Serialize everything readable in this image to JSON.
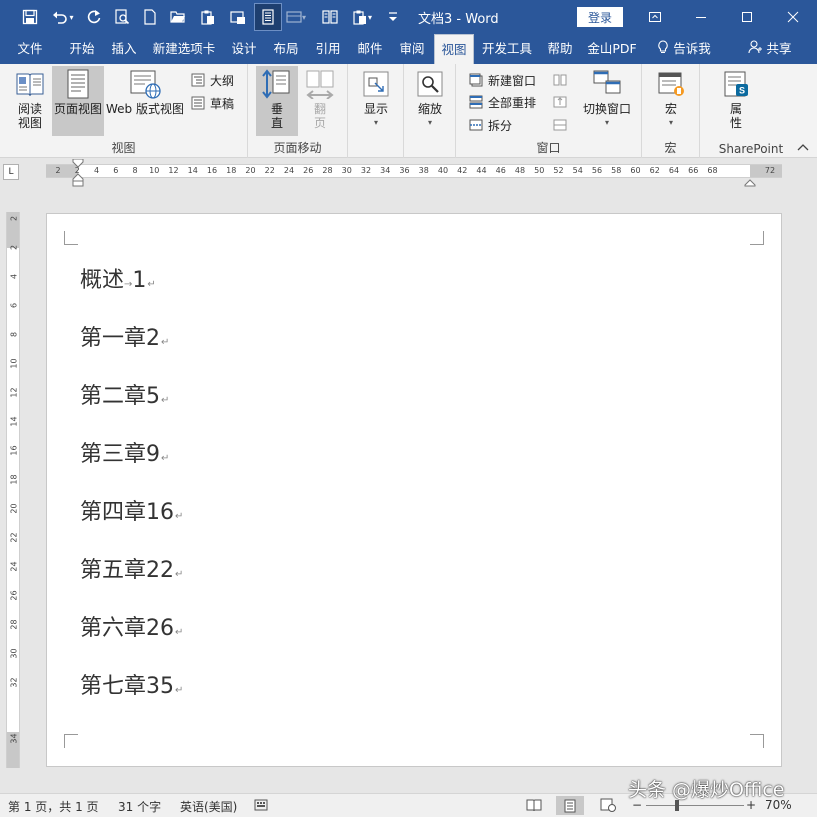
{
  "titlebar": {
    "doc_title": "文档3  -  Word",
    "login_label": "登录",
    "qat_icons": [
      "save-icon",
      "undo-icon",
      "redo-icon",
      "print-preview-icon",
      "new-doc-icon",
      "open-folder-icon",
      "paste-icon",
      "screenshot-icon",
      "one-page-icon",
      "multi-page-icon",
      "side-by-side-icon",
      "paste-special-icon",
      "customize-qat-icon"
    ],
    "window_controls": [
      "ribbon-display-icon",
      "minimize-icon",
      "maximize-icon",
      "close-icon"
    ]
  },
  "tabs": [
    {
      "label": "文件"
    },
    {
      "label": "开始"
    },
    {
      "label": "插入"
    },
    {
      "label": "新建选项卡"
    },
    {
      "label": "设计"
    },
    {
      "label": "布局"
    },
    {
      "label": "引用"
    },
    {
      "label": "邮件"
    },
    {
      "label": "审阅"
    },
    {
      "label": "视图",
      "active": true
    },
    {
      "label": "开发工具"
    },
    {
      "label": "帮助"
    },
    {
      "label": "金山PDF"
    },
    {
      "label": "告诉我"
    },
    {
      "label": "共享"
    }
  ],
  "ribbon": {
    "views": {
      "read_line1": "阅读",
      "read_line2": "视图",
      "page_view": "页面视图",
      "web_view": "Web 版式视图",
      "outline": "大纲",
      "draft": "草稿",
      "group_label": "视图"
    },
    "page_movement": {
      "vertical_line1": "垂",
      "vertical_line2": "直",
      "flip_line1": "翻",
      "flip_line2": "页",
      "group_label": "页面移动"
    },
    "show": {
      "label": "显示"
    },
    "zoom": {
      "label": "缩放"
    },
    "window": {
      "new_window": "新建窗口",
      "arrange_all": "全部重排",
      "split": "拆分",
      "switch_windows": "切换窗口",
      "group_label": "窗口"
    },
    "macros": {
      "label": "宏",
      "group_label": "宏"
    },
    "sharepoint": {
      "line1": "属",
      "line2": "性",
      "group_label": "SharePoint"
    }
  },
  "ruler": {
    "h_ticks": [
      "2",
      "2",
      "4",
      "6",
      "8",
      "10",
      "12",
      "14",
      "16",
      "18",
      "20",
      "22",
      "24",
      "26",
      "28",
      "30",
      "32",
      "34",
      "36",
      "38",
      "40",
      "42",
      "44",
      "46",
      "48",
      "50",
      "52",
      "54",
      "56",
      "58",
      "60",
      "62",
      "64",
      "66",
      "68",
      "72"
    ],
    "v_ticks": [
      "2",
      "2",
      "4",
      "6",
      "8",
      "10",
      "12",
      "14",
      "16",
      "18",
      "20",
      "22",
      "24",
      "26",
      "28",
      "30",
      "32",
      "34"
    ],
    "corner_symbol": "L"
  },
  "document": {
    "toc_lines": [
      {
        "title": "概述",
        "page": "1"
      },
      {
        "title": "第一章",
        "page": "2"
      },
      {
        "title": "第二章",
        "page": "5"
      },
      {
        "title": "第三章",
        "page": "9"
      },
      {
        "title": "第四章",
        "page": "16"
      },
      {
        "title": "第五章",
        "page": "22"
      },
      {
        "title": "第六章",
        "page": "26"
      },
      {
        "title": "第七章",
        "page": "35"
      }
    ],
    "tab_mark": "→",
    "para_mark": "↵"
  },
  "statusbar": {
    "page_info": "第 1 页，共 1 页",
    "word_count": "31 个字",
    "language": "英语(美国)",
    "zoom_level": "70%",
    "zoom_minus": "−",
    "zoom_plus": "+"
  },
  "watermark": "头条 @爆炒Office",
  "colors": {
    "accent": "#2b579a",
    "ribbon_bg": "#f3f3f3",
    "canvas_bg": "#e6e6e6"
  }
}
